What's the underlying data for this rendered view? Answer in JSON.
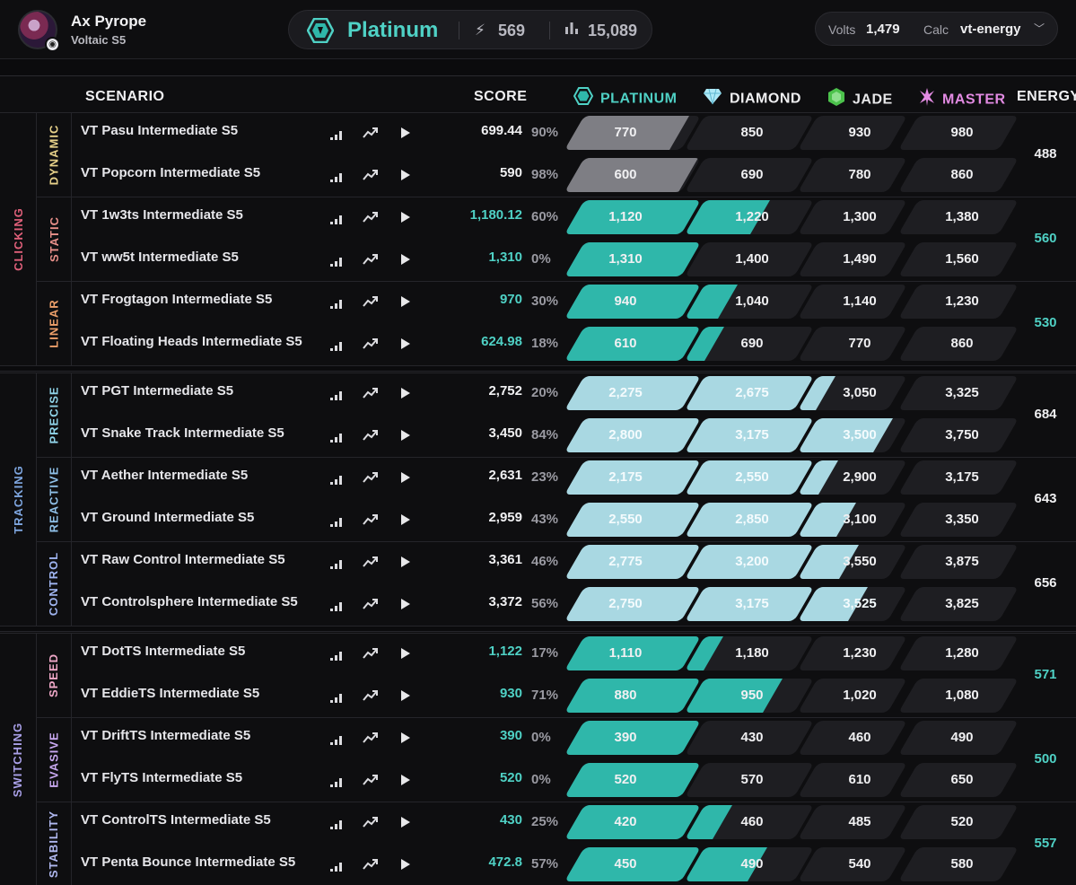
{
  "user": {
    "name": "Ax Pyrope",
    "season": "Voltaic S5"
  },
  "rank": {
    "name": "Platinum",
    "energy": "569",
    "score_total": "15,089"
  },
  "calc": {
    "volts_label": "Volts",
    "volts_value": "1,479",
    "calc_label": "Calc",
    "calc_value": "vt-energy"
  },
  "columns": {
    "scenario": "SCENARIO",
    "score": "SCORE",
    "platinum": "PLATINUM",
    "diamond": "DIAMOND",
    "jade": "JADE",
    "master": "MASTER",
    "energy": "ENERGY"
  },
  "colors": {
    "platinum": "#4fd1c5",
    "diamond": "#aee9f7",
    "jade": "#5fd35f",
    "master": "#e38be3",
    "teal_fill": "#2fb7aa",
    "light_fill": "#a9d8e2",
    "gray_fill": "#7e7e84"
  },
  "categories": [
    {
      "name": "CLICKING",
      "color": "#e0607a",
      "subs": [
        {
          "name": "DYNAMIC",
          "color": "#e8d28a",
          "energy": "488",
          "energy_color": "#f0f0f2",
          "fill": "gray",
          "rows": [
            {
              "name": "VT Pasu Intermediate S5",
              "score": "699.44",
              "pct": "90%",
              "score_color": "#f0f0f2",
              "fills": [
                0.9,
                0,
                0,
                0
              ],
              "thresholds": [
                "770",
                "850",
                "930",
                "980"
              ]
            },
            {
              "name": "VT Popcorn Intermediate S5",
              "score": "590",
              "pct": "98%",
              "score_color": "#f0f0f2",
              "fills": [
                0.98,
                0,
                0,
                0
              ],
              "thresholds": [
                "600",
                "690",
                "780",
                "860"
              ]
            }
          ]
        },
        {
          "name": "STATIC",
          "color": "#e9908a",
          "energy": "560",
          "energy_color": "#4fd1c5",
          "fill": "teal",
          "rows": [
            {
              "name": "VT 1w3ts Intermediate S5",
              "score": "1,180.12",
              "pct": "60%",
              "score_color": "#4fd1c5",
              "fills": [
                1,
                0.6,
                0,
                0
              ],
              "thresholds": [
                "1,120",
                "1,220",
                "1,300",
                "1,380"
              ]
            },
            {
              "name": "VT ww5t Intermediate S5",
              "score": "1,310",
              "pct": "0%",
              "score_color": "#4fd1c5",
              "fills": [
                1,
                0,
                0,
                0
              ],
              "thresholds": [
                "1,310",
                "1,400",
                "1,490",
                "1,560"
              ]
            }
          ]
        },
        {
          "name": "LINEAR",
          "color": "#eea06a",
          "energy": "530",
          "energy_color": "#4fd1c5",
          "fill": "teal",
          "rows": [
            {
              "name": "VT Frogtagon Intermediate S5",
              "score": "970",
              "pct": "30%",
              "score_color": "#4fd1c5",
              "fills": [
                1,
                0.3,
                0,
                0
              ],
              "thresholds": [
                "940",
                "1,040",
                "1,140",
                "1,230"
              ]
            },
            {
              "name": "VT Floating Heads Intermediate S5",
              "score": "624.98",
              "pct": "18%",
              "score_color": "#4fd1c5",
              "fills": [
                1,
                0.18,
                0,
                0
              ],
              "thresholds": [
                "610",
                "690",
                "770",
                "860"
              ]
            }
          ]
        }
      ]
    },
    {
      "name": "TRACKING",
      "color": "#7ea6e0",
      "subs": [
        {
          "name": "PRECISE",
          "color": "#8fd3e8",
          "energy": "684",
          "energy_color": "#f0f0f2",
          "fill": "light",
          "rows": [
            {
              "name": "VT PGT Intermediate S5",
              "score": "2,752",
              "pct": "20%",
              "score_color": "#f0f0f2",
              "fills": [
                1,
                1,
                0.2,
                0
              ],
              "thresholds": [
                "2,275",
                "2,675",
                "3,050",
                "3,325"
              ]
            },
            {
              "name": "VT Snake Track Intermediate S5",
              "score": "3,450",
              "pct": "84%",
              "score_color": "#f0f0f2",
              "fills": [
                1,
                1,
                0.84,
                0
              ],
              "thresholds": [
                "2,800",
                "3,175",
                "3,500",
                "3,750"
              ]
            }
          ]
        },
        {
          "name": "REACTIVE",
          "color": "#8fc0e8",
          "energy": "643",
          "energy_color": "#f0f0f2",
          "fill": "light",
          "rows": [
            {
              "name": "VT Aether Intermediate S5",
              "score": "2,631",
              "pct": "23%",
              "score_color": "#f0f0f2",
              "fills": [
                1,
                1,
                0.23,
                0
              ],
              "thresholds": [
                "2,175",
                "2,550",
                "2,900",
                "3,175"
              ]
            },
            {
              "name": "VT Ground Intermediate S5",
              "score": "2,959",
              "pct": "43%",
              "score_color": "#f0f0f2",
              "fills": [
                1,
                1,
                0.43,
                0
              ],
              "thresholds": [
                "2,550",
                "2,850",
                "3,100",
                "3,350"
              ]
            }
          ]
        },
        {
          "name": "CONTROL",
          "color": "#9fb4f0",
          "energy": "656",
          "energy_color": "#f0f0f2",
          "fill": "light",
          "rows": [
            {
              "name": "VT Raw Control Intermediate S5",
              "score": "3,361",
              "pct": "46%",
              "score_color": "#f0f0f2",
              "fills": [
                1,
                1,
                0.46,
                0
              ],
              "thresholds": [
                "2,775",
                "3,200",
                "3,550",
                "3,875"
              ]
            },
            {
              "name": "VT Controlsphere Intermediate S5",
              "score": "3,372",
              "pct": "56%",
              "score_color": "#f0f0f2",
              "fills": [
                1,
                1,
                0.56,
                0
              ],
              "thresholds": [
                "2,750",
                "3,175",
                "3,525",
                "3,825"
              ]
            }
          ]
        }
      ]
    },
    {
      "name": "SWITCHING",
      "color": "#a9a0e8",
      "subs": [
        {
          "name": "SPEED",
          "color": "#f0a8c8",
          "energy": "571",
          "energy_color": "#4fd1c5",
          "fill": "teal",
          "rows": [
            {
              "name": "VT DotTS Intermediate S5",
              "score": "1,122",
              "pct": "17%",
              "score_color": "#4fd1c5",
              "fills": [
                1,
                0.17,
                0,
                0
              ],
              "thresholds": [
                "1,110",
                "1,180",
                "1,230",
                "1,280"
              ]
            },
            {
              "name": "VT EddieTS Intermediate S5",
              "score": "930",
              "pct": "71%",
              "score_color": "#4fd1c5",
              "fills": [
                1,
                0.71,
                0,
                0
              ],
              "thresholds": [
                "880",
                "950",
                "1,020",
                "1,080"
              ]
            }
          ]
        },
        {
          "name": "EVASIVE",
          "color": "#c8a8f0",
          "energy": "500",
          "energy_color": "#4fd1c5",
          "fill": "teal",
          "rows": [
            {
              "name": "VT DriftTS Intermediate S5",
              "score": "390",
              "pct": "0%",
              "score_color": "#4fd1c5",
              "fills": [
                1,
                0,
                0,
                0
              ],
              "thresholds": [
                "390",
                "430",
                "460",
                "490"
              ]
            },
            {
              "name": "VT FlyTS Intermediate S5",
              "score": "520",
              "pct": "0%",
              "score_color": "#4fd1c5",
              "fills": [
                1,
                0,
                0,
                0
              ],
              "thresholds": [
                "520",
                "570",
                "610",
                "650"
              ]
            }
          ]
        },
        {
          "name": "STABILITY",
          "color": "#b0b8f0",
          "energy": "557",
          "energy_color": "#4fd1c5",
          "fill": "teal",
          "rows": [
            {
              "name": "VT ControlTS Intermediate S5",
              "score": "430",
              "pct": "25%",
              "score_color": "#4fd1c5",
              "fills": [
                1,
                0.25,
                0,
                0
              ],
              "thresholds": [
                "420",
                "460",
                "485",
                "520"
              ]
            },
            {
              "name": "VT Penta Bounce Intermediate S5",
              "score": "472.8",
              "pct": "57%",
              "score_color": "#4fd1c5",
              "fills": [
                1,
                0.57,
                0,
                0
              ],
              "thresholds": [
                "450",
                "490",
                "540",
                "580"
              ]
            }
          ]
        }
      ]
    }
  ]
}
